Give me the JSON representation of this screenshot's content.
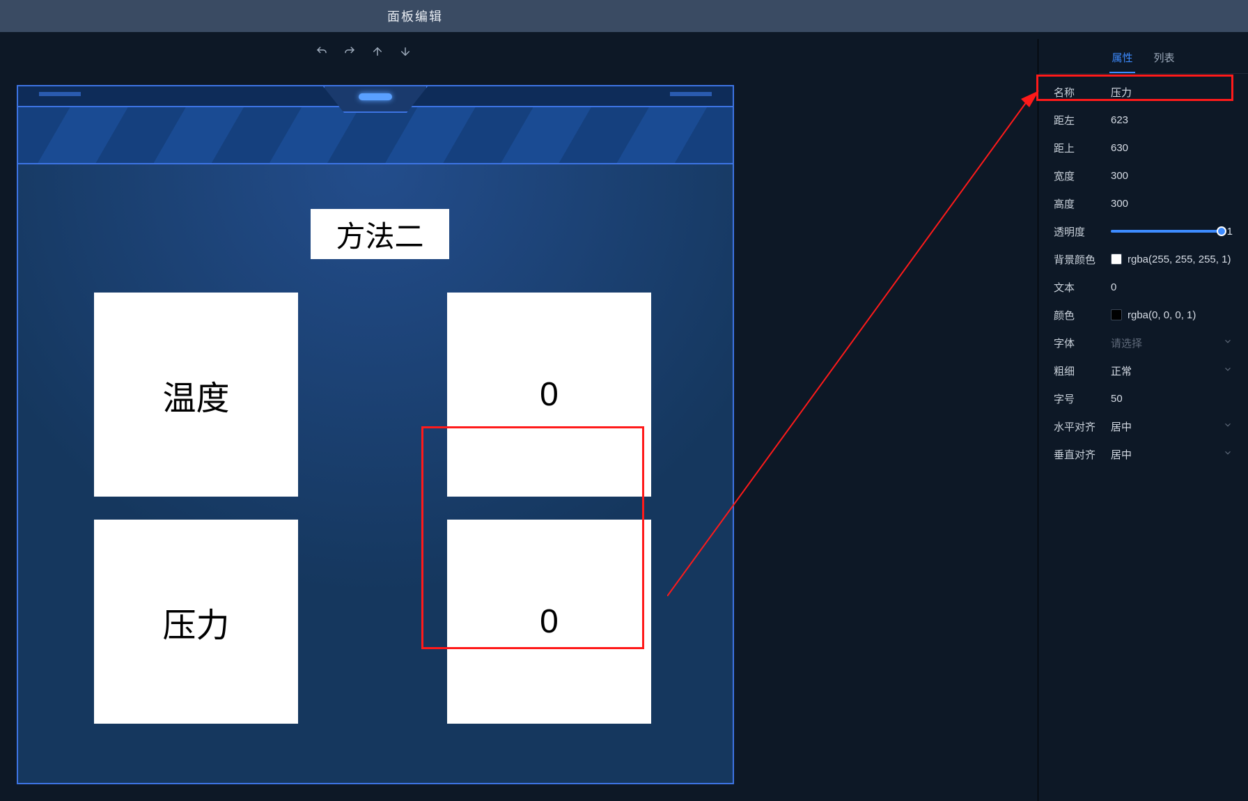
{
  "titlebar": {
    "title": "面板编辑"
  },
  "toolbar": {
    "undo": "undo",
    "redo": "redo",
    "up": "up",
    "down": "down"
  },
  "canvas": {
    "title_card": "方法二",
    "temp_label": "温度",
    "temp_value": "0",
    "press_label": "压力",
    "press_value": "0"
  },
  "panel": {
    "tabs": {
      "props": "属性",
      "list": "列表"
    },
    "rows": {
      "name": {
        "label": "名称",
        "value": "压力"
      },
      "left": {
        "label": "距左",
        "value": "623"
      },
      "top": {
        "label": "距上",
        "value": "630"
      },
      "width": {
        "label": "宽度",
        "value": "300"
      },
      "height": {
        "label": "高度",
        "value": "300"
      },
      "opacity": {
        "label": "透明度",
        "value": "1"
      },
      "bg": {
        "label": "背景颜色",
        "value": "rgba(255, 255, 255, 1)"
      },
      "text": {
        "label": "文本",
        "value": "0"
      },
      "color": {
        "label": "颜色",
        "value": "rgba(0, 0, 0, 1)"
      },
      "font": {
        "label": "字体",
        "value": "请选择"
      },
      "weight": {
        "label": "粗细",
        "value": "正常"
      },
      "size": {
        "label": "字号",
        "value": "50"
      },
      "halign": {
        "label": "水平对齐",
        "value": "居中"
      },
      "valign": {
        "label": "垂直对齐",
        "value": "居中"
      }
    }
  }
}
